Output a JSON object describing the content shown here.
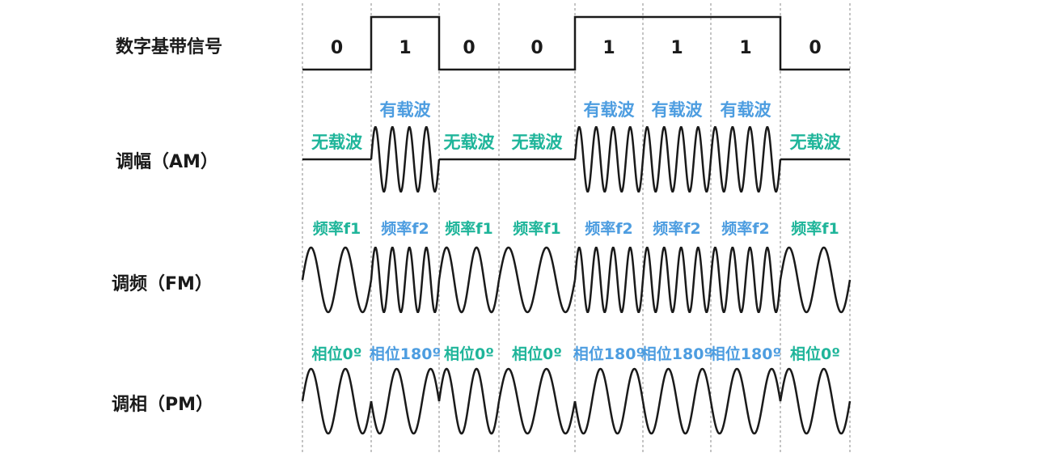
{
  "rows": {
    "digital": "数字基带信号",
    "am": "调幅（AM）",
    "fm": "调频（FM）",
    "pm": "调相（PM）"
  },
  "bits": [
    "0",
    "1",
    "0",
    "0",
    "1",
    "1",
    "1",
    "0"
  ],
  "am_labels": [
    "无载波",
    "有载波",
    "无载波",
    "无载波",
    "有载波",
    "有载波",
    "有载波",
    "无载波"
  ],
  "fm_labels": [
    "频率f1",
    "频率f2",
    "频率f1",
    "频率f1",
    "频率f2",
    "频率f2",
    "频率f2",
    "频率f1"
  ],
  "pm_labels": [
    "相位0º",
    "相位180º",
    "相位0º",
    "相位0º",
    "相位180º",
    "相位180º",
    "相位180º",
    "相位0º"
  ],
  "colors": {
    "label_zero": "#1fb59a",
    "label_one": "#4d9de0",
    "line": "#1a1a1a",
    "gridline": "#888888"
  }
}
